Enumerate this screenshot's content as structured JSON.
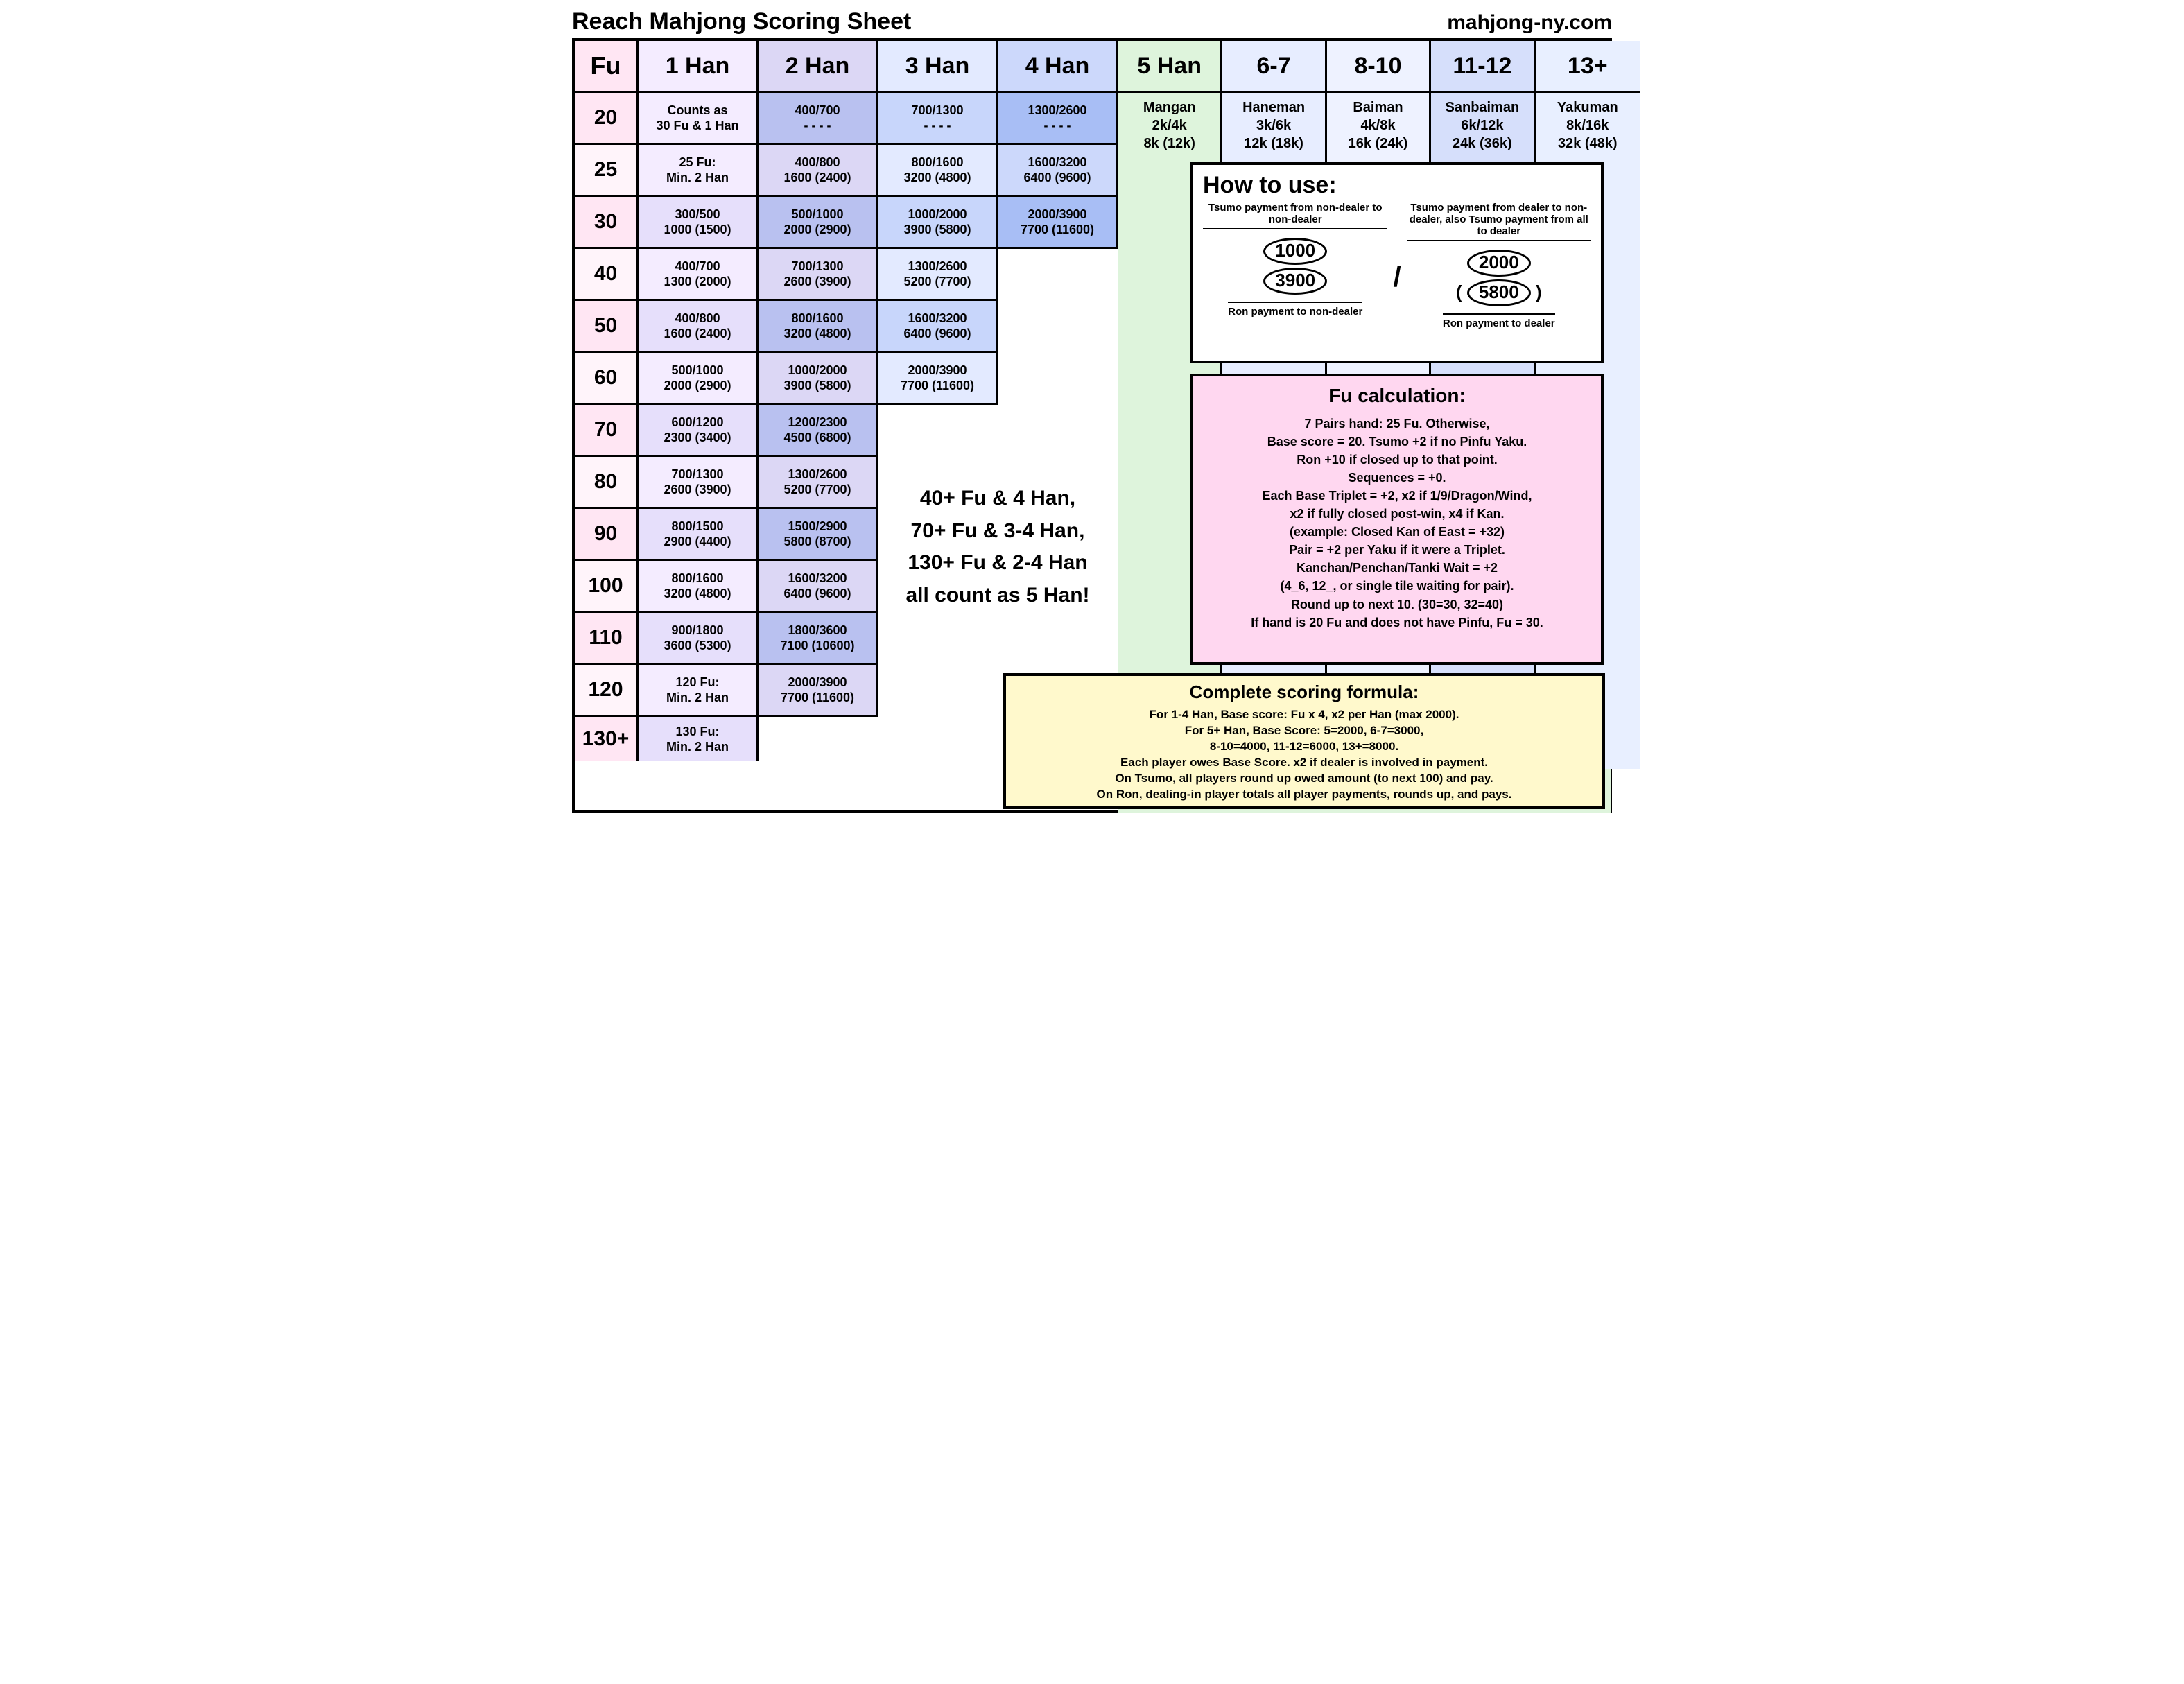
{
  "title": "Reach Mahjong Scoring Sheet",
  "url": "mahjong-ny.com",
  "headers": [
    "Fu",
    "1 Han",
    "2 Han",
    "3 Han",
    "4 Han",
    "5 Han",
    "6-7",
    "8-10",
    "11-12",
    "13+"
  ],
  "limit_cols": [
    {
      "name": "Mangan",
      "tsumo": "2k/4k",
      "ron": "8k (12k)"
    },
    {
      "name": "Haneman",
      "tsumo": "3k/6k",
      "ron": "12k (18k)"
    },
    {
      "name": "Baiman",
      "tsumo": "4k/8k",
      "ron": "16k (24k)"
    },
    {
      "name": "Sanbaiman",
      "tsumo": "6k/12k",
      "ron": "24k (36k)"
    },
    {
      "name": "Yakuman",
      "tsumo": "8k/16k",
      "ron": "32k (48k)"
    }
  ],
  "fu_rows": [
    "20",
    "25",
    "30",
    "40",
    "50",
    "60",
    "70",
    "80",
    "90",
    "100",
    "110",
    "120",
    "130+"
  ],
  "cells": {
    "r20": [
      {
        "l1": "Counts as",
        "l2": "30 Fu & 1 Han"
      },
      {
        "l1": "400/700",
        "l2": "- - - -"
      },
      {
        "l1": "700/1300",
        "l2": "- - - -"
      },
      {
        "l1": "1300/2600",
        "l2": "- - - -"
      }
    ],
    "r25": [
      {
        "l1": "25 Fu:",
        "l2": "Min. 2 Han"
      },
      {
        "l1": "400/800",
        "l2": "1600 (2400)"
      },
      {
        "l1": "800/1600",
        "l2": "3200 (4800)"
      },
      {
        "l1": "1600/3200",
        "l2": "6400 (9600)"
      }
    ],
    "r30": [
      {
        "l1": "300/500",
        "l2": "1000 (1500)"
      },
      {
        "l1": "500/1000",
        "l2": "2000 (2900)"
      },
      {
        "l1": "1000/2000",
        "l2": "3900 (5800)"
      },
      {
        "l1": "2000/3900",
        "l2": "7700 (11600)"
      }
    ],
    "r40": [
      {
        "l1": "400/700",
        "l2": "1300 (2000)"
      },
      {
        "l1": "700/1300",
        "l2": "2600 (3900)"
      },
      {
        "l1": "1300/2600",
        "l2": "5200 (7700)"
      }
    ],
    "r50": [
      {
        "l1": "400/800",
        "l2": "1600 (2400)"
      },
      {
        "l1": "800/1600",
        "l2": "3200 (4800)"
      },
      {
        "l1": "1600/3200",
        "l2": "6400 (9600)"
      }
    ],
    "r60": [
      {
        "l1": "500/1000",
        "l2": "2000 (2900)"
      },
      {
        "l1": "1000/2000",
        "l2": "3900 (5800)"
      },
      {
        "l1": "2000/3900",
        "l2": "7700 (11600)"
      }
    ],
    "r70": [
      {
        "l1": "600/1200",
        "l2": "2300 (3400)"
      },
      {
        "l1": "1200/2300",
        "l2": "4500 (6800)"
      }
    ],
    "r80": [
      {
        "l1": "700/1300",
        "l2": "2600 (3900)"
      },
      {
        "l1": "1300/2600",
        "l2": "5200 (7700)"
      }
    ],
    "r90": [
      {
        "l1": "800/1500",
        "l2": "2900 (4400)"
      },
      {
        "l1": "1500/2900",
        "l2": "5800 (8700)"
      }
    ],
    "r100": [
      {
        "l1": "800/1600",
        "l2": "3200 (4800)"
      },
      {
        "l1": "1600/3200",
        "l2": "6400 (9600)"
      }
    ],
    "r110": [
      {
        "l1": "900/1800",
        "l2": "3600 (5300)"
      },
      {
        "l1": "1800/3600",
        "l2": "7100 (10600)"
      }
    ],
    "r120": [
      {
        "l1": "120 Fu:",
        "l2": "Min. 2 Han"
      },
      {
        "l1": "2000/3900",
        "l2": "7700 (11600)"
      }
    ],
    "r130": [
      {
        "l1": "130 Fu:",
        "l2": "Min. 2 Han"
      }
    ]
  },
  "note5": [
    "40+ Fu & 4 Han,",
    "70+ Fu & 3-4 Han,",
    "130+ Fu & 2-4 Han",
    "all count as 5 Han!"
  ],
  "howto": {
    "title": "How to use:",
    "left_top": "Tsumo payment from non-dealer to non-dealer",
    "right_top": "Tsumo payment from dealer to non-dealer, also Tsumo payment from all to dealer",
    "n1": "1000",
    "n2": "2000",
    "n3": "3900",
    "n4": "5800",
    "left_bot": "Ron payment to non-dealer",
    "right_bot": "Ron payment to dealer"
  },
  "fubox": {
    "title": "Fu calculation:",
    "lines": [
      "7 Pairs hand: 25 Fu. Otherwise,",
      "Base score = 20. Tsumo +2 if no Pinfu Yaku.",
      "Ron +10 if closed up to that point.",
      "Sequences = +0.",
      "Each Base Triplet = +2, x2 if 1/9/Dragon/Wind,",
      "x2 if fully closed post-win, x4 if Kan.",
      "(example: Closed Kan of East = +32)",
      "Pair = +2 per Yaku if it were a Triplet.",
      "Kanchan/Penchan/Tanki Wait = +2",
      "(4_6, 12_, or single tile waiting for pair).",
      "Round up to next 10. (30=30, 32=40)",
      "If hand is 20 Fu and does not have Pinfu, Fu = 30."
    ]
  },
  "formulabox": {
    "title": "Complete scoring formula:",
    "lines": [
      "For 1-4 Han, Base score: Fu x 4, x2 per Han (max 2000).",
      "For 5+ Han, Base Score: 5=2000, 6-7=3000,",
      "8-10=4000, 11-12=6000, 13+=8000.",
      "Each player owes Base Score. x2 if dealer is involved in payment.",
      "On Tsumo, all players round up owed amount (to next 100) and pay.",
      "On Ron, dealing-in player totals all player payments, rounds up, and pays."
    ]
  }
}
